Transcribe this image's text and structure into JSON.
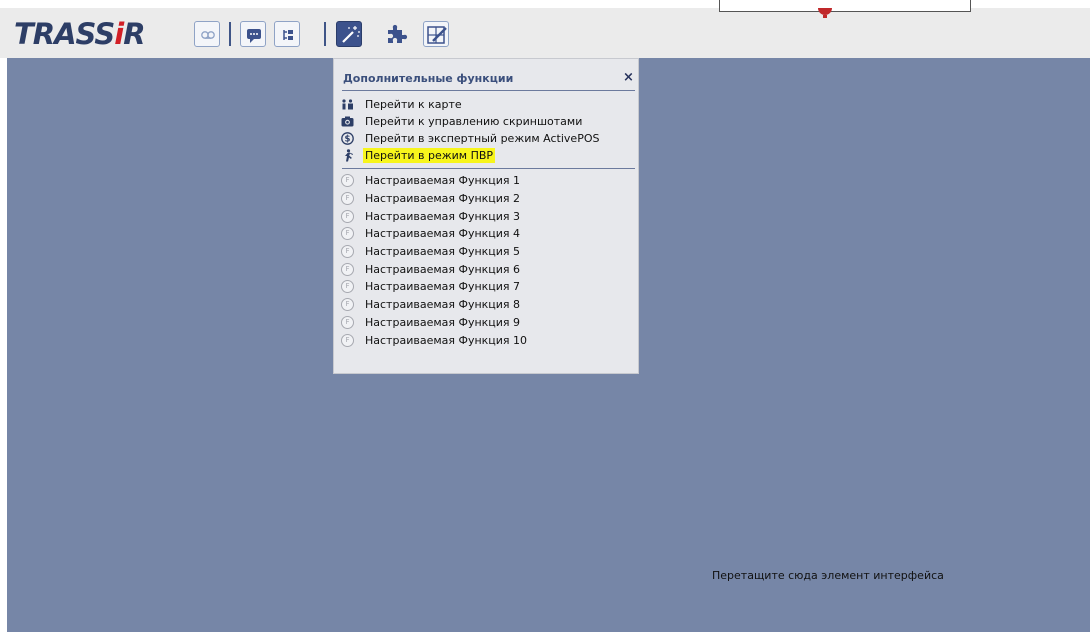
{
  "app": {
    "logo_prefix": "TRASS",
    "logo_i": "i",
    "logo_suffix": "R"
  },
  "toolbar": {
    "buttons": [
      {
        "name": "voicemail-button",
        "icon": "voicemail-icon"
      },
      {
        "name": "chat-button",
        "icon": "chat-icon"
      },
      {
        "name": "layout-tree-button",
        "icon": "tree-icon"
      },
      {
        "name": "magic-wand-button",
        "icon": "magic-wand-icon"
      },
      {
        "name": "plugin-button",
        "icon": "puzzle-icon"
      },
      {
        "name": "edit-layout-button",
        "icon": "edit-grid-icon"
      }
    ]
  },
  "panel": {
    "title": "Дополнительные функции",
    "close_label": "×",
    "items": [
      {
        "label": "Перейти к карте",
        "icon": "map-person-icon"
      },
      {
        "label": "Перейти к управлению скриншотами",
        "icon": "camera-icon"
      },
      {
        "label": "Перейти в экспертный режим ActivePOS",
        "icon": "dollar-circle-icon"
      },
      {
        "label": "Перейти в режим ПВР",
        "icon": "running-person-icon",
        "highlighted": true
      }
    ],
    "functions": [
      {
        "label": "Настраиваемая Функция 1",
        "badge": "F"
      },
      {
        "label": "Настраиваемая Функция 2",
        "badge": "F"
      },
      {
        "label": "Настраиваемая Функция 3",
        "badge": "F"
      },
      {
        "label": "Настраиваемая Функция 4",
        "badge": "F"
      },
      {
        "label": "Настраиваемая Функция 5",
        "badge": "F"
      },
      {
        "label": "Настраиваемая Функция 6",
        "badge": "F"
      },
      {
        "label": "Настраиваемая Функция 7",
        "badge": "F"
      },
      {
        "label": "Настраиваемая Функция 8",
        "badge": "F"
      },
      {
        "label": "Настраиваемая Функция 9",
        "badge": "F"
      },
      {
        "label": "Настраиваемая Функция 10",
        "badge": "F"
      }
    ]
  },
  "workspace": {
    "drop_hint": "Перетащите сюда элемент интерфейса"
  },
  "colors": {
    "brand_navy": "#2d3e66",
    "brand_red": "#d21f26",
    "workspace_bg": "#7686a7",
    "highlight": "#f7f51c"
  }
}
